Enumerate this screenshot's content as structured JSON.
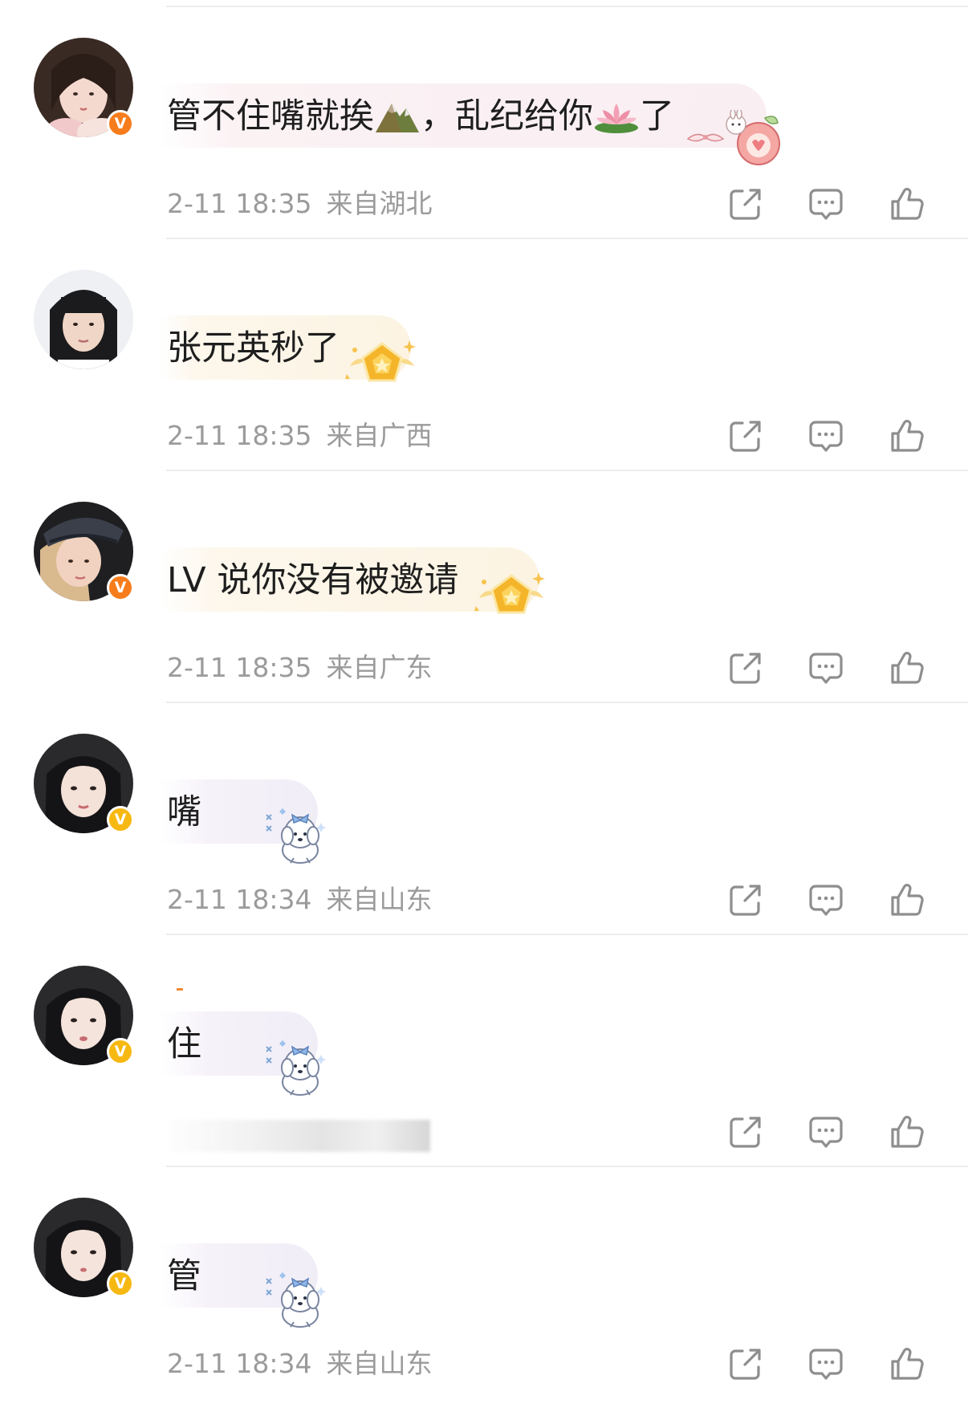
{
  "comments": [
    {
      "text_parts": [
        "管不住嘴就挨",
        "，乱纪给你",
        "了"
      ],
      "time": "2-11 18:35",
      "location": "来自湖北",
      "badge": "V",
      "badge_color": "#f77c1c",
      "bubble_style": "pink",
      "inline_icons": [
        "mountain-emoji-icon",
        "lotus-emoji-icon"
      ],
      "decoration_icon": "bunny-apple-sticker-icon"
    },
    {
      "text": "张元英秒了",
      "time": "2-11 18:35",
      "location": "来自广西",
      "bubble_style": "cream",
      "decoration_icon": "gold-pentagon-badge-icon"
    },
    {
      "text": "LV 说你没有被邀请",
      "time": "2-11 18:35",
      "location": "来自广东",
      "badge": "V",
      "badge_color": "#f77c1c",
      "bubble_style": "cream",
      "decoration_icon": "gold-pentagon-badge-icon"
    },
    {
      "text": "嘴",
      "time": "2-11 18:34",
      "location": "来自山东",
      "badge": "V",
      "badge_color": "#f7b812",
      "bubble_style": "lavender",
      "decoration_icon": "puppy-bow-sticker-icon"
    },
    {
      "text": "住",
      "meta_obscured": true,
      "badge": "V",
      "badge_color": "#f7b812",
      "bubble_style": "lavender",
      "decoration_icon": "puppy-bow-sticker-icon"
    },
    {
      "text": "管",
      "time": "2-11 18:34",
      "location": "来自山东",
      "badge": "V",
      "badge_color": "#f7b812",
      "bubble_style": "lavender",
      "decoration_icon": "puppy-bow-sticker-icon"
    }
  ],
  "actions": {
    "share_icon": "share-icon",
    "comment_icon": "comment-icon",
    "like_icon": "like-icon"
  },
  "colors": {
    "meta_text": "#9b9b9b",
    "body_text": "#1e1e1e",
    "divider": "#ececec",
    "icon_stroke": "#8e8e8e"
  }
}
